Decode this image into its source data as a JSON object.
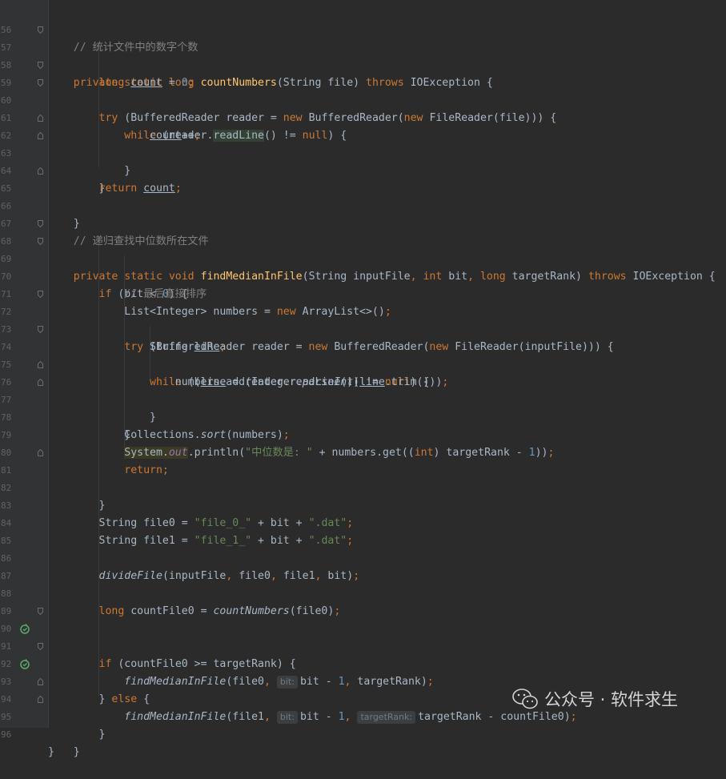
{
  "editor": {
    "line_numbers": [
      "56",
      "57",
      "58",
      "59",
      "60",
      "61",
      "62",
      "63",
      "64",
      "65",
      "66",
      "67",
      "68",
      "69",
      "70",
      "71",
      "72",
      "73",
      "74",
      "75",
      "76",
      "77",
      "78",
      "79",
      "80",
      "81",
      "82",
      "83",
      "84",
      "85",
      "86",
      "87",
      "88",
      "89",
      "90",
      "91",
      "92",
      "93",
      "94",
      "95",
      "96"
    ],
    "comment_1": "// 统计文件中的数字个数",
    "comment_2": "// 递归查找中位数所在文件",
    "comment_3": "// 最后直接排序",
    "string_median": "\"中位数是: \"",
    "string_file0": "\"file_0_\"",
    "string_file1": "\"file_1_\"",
    "string_dat": "\".dat\"",
    "hint_bit": "bit:",
    "hint_target_rank": "targetRank:",
    "colors": {
      "background": "#2b2b2b",
      "keyword": "#cc7832",
      "function": "#ffc66d",
      "string": "#6a8759",
      "number": "#6897bb",
      "comment": "#808080",
      "field": "#9876aa"
    }
  },
  "watermark": {
    "text": "公众号 · 软件求生",
    "icon": "wechat-icon"
  }
}
